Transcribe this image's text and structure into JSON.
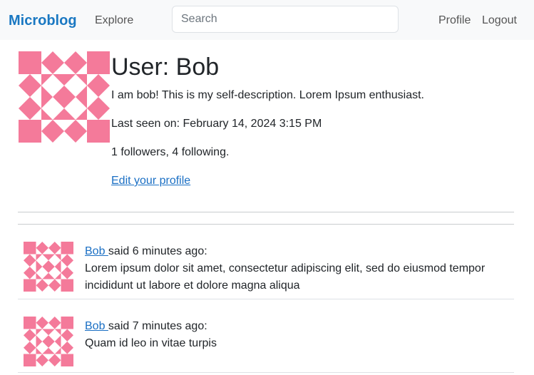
{
  "nav": {
    "brand": "Microblog",
    "explore": "Explore",
    "search_placeholder": "Search",
    "profile": "Profile",
    "logout": "Logout"
  },
  "profile": {
    "title": "User: Bob",
    "about": "I am bob! This is my self-description. Lorem Ipsum enthusiast.",
    "last_seen": "Last seen on: February 14, 2024 3:15 PM",
    "follow_stats": "1 followers, 4 following.",
    "edit_link": "Edit your profile",
    "avatar_color": "#f47a9a"
  },
  "posts": [
    {
      "author": "Bob ",
      "meta": "said 6 minutes ago:",
      "body": "Lorem ipsum dolor sit amet, consectetur adipiscing elit, sed do eiusmod tempor incididunt ut labore et dolore magna aliqua"
    },
    {
      "author": "Bob ",
      "meta": "said 7 minutes ago:",
      "body": "Quam id leo in vitae turpis"
    }
  ]
}
